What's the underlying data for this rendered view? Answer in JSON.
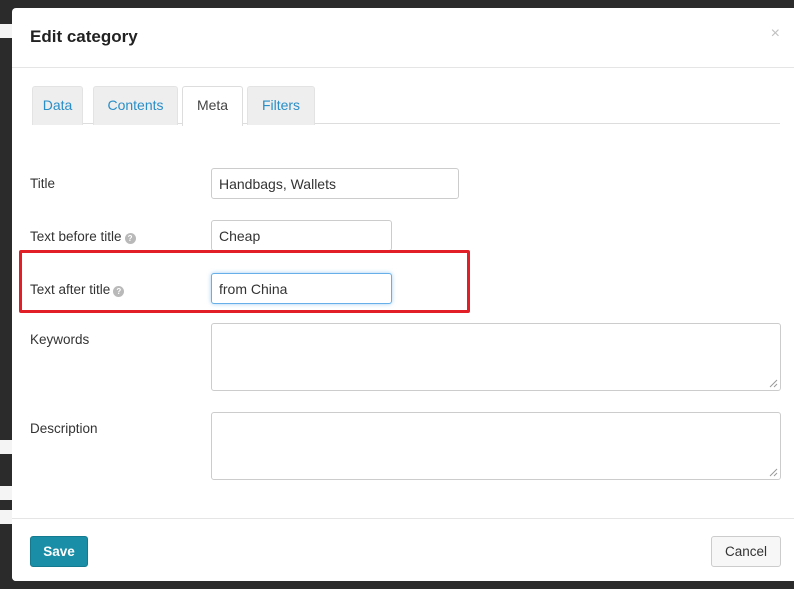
{
  "modal": {
    "title": "Edit category",
    "close_glyph": "×"
  },
  "tabs": [
    {
      "label": "Data",
      "active": false
    },
    {
      "label": "Contents",
      "active": false
    },
    {
      "label": "Meta",
      "active": true
    },
    {
      "label": "Filters",
      "active": false
    }
  ],
  "form": {
    "title": {
      "label": "Title",
      "value": "Handbags, Wallets"
    },
    "text_before_title": {
      "label": "Text before title",
      "value": "Cheap",
      "help_icon": "question-circle-icon"
    },
    "text_after_title": {
      "label": "Text after title",
      "value": "from China",
      "help_icon": "question-circle-icon"
    },
    "keywords": {
      "label": "Keywords",
      "value": ""
    },
    "description": {
      "label": "Description",
      "value": ""
    }
  },
  "footer": {
    "save_label": "Save",
    "cancel_label": "Cancel"
  },
  "colors": {
    "accent": "#1a8ea6",
    "tab_link": "#2a8ec7",
    "highlight": "#e21f26",
    "focus": "#66afe9"
  }
}
